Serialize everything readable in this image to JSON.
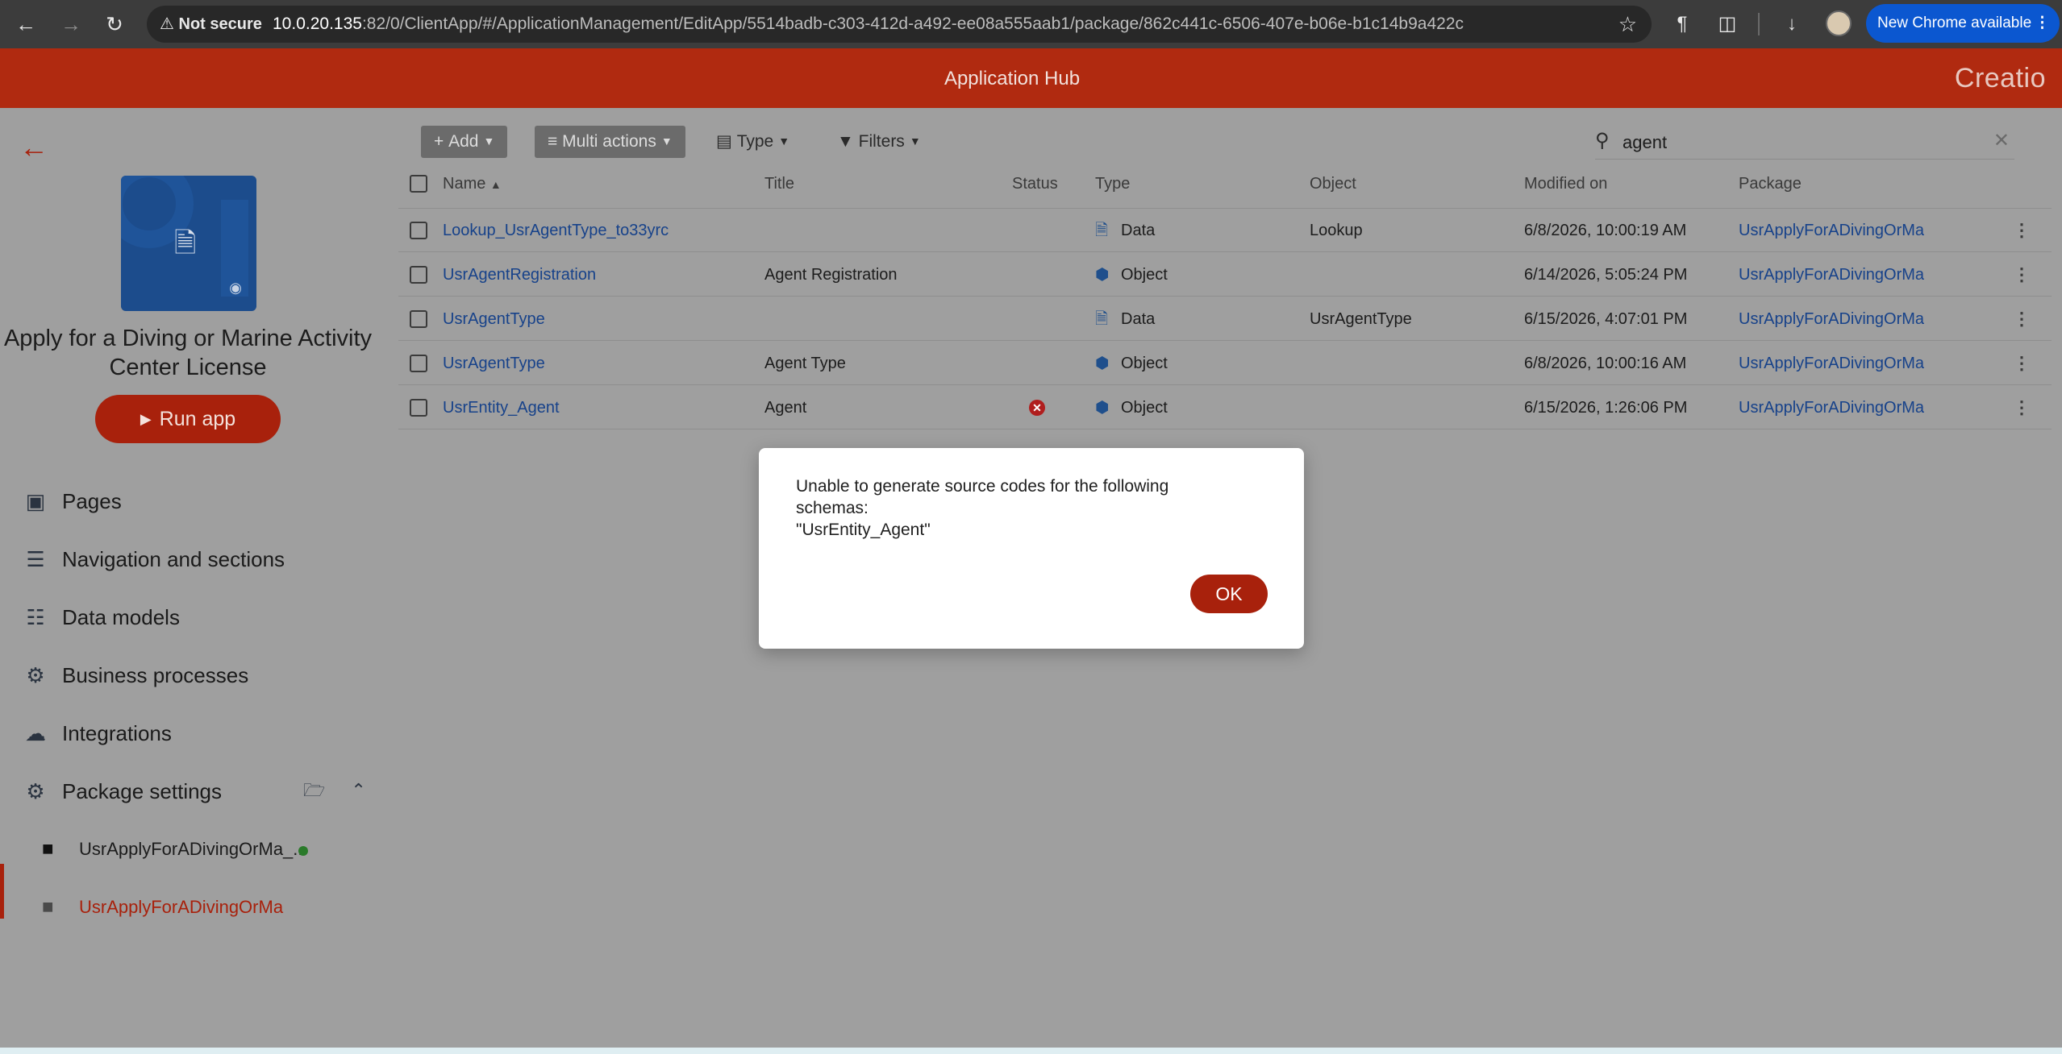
{
  "browser": {
    "security_label": "Not secure",
    "url_host": "10.0.20.135",
    "url_rest": ":82/0/ClientApp/#/ApplicationManagement/EditApp/5514badb-c303-412d-a492-ee08a555aab1/package/862c441c-6506-407e-b06e-b1c14b9a422c",
    "new_chrome_label": "New Chrome available"
  },
  "header": {
    "title": "Application Hub",
    "logo": "Creatio"
  },
  "app": {
    "name": "Apply for a Diving or Marine Activity Center License",
    "run_label": "Run app"
  },
  "menu": [
    {
      "label": "Pages",
      "icon": "window-icon"
    },
    {
      "label": "Navigation and sections",
      "icon": "list-icon"
    },
    {
      "label": "Data models",
      "icon": "database-icon"
    },
    {
      "label": "Business processes",
      "icon": "process-icon"
    },
    {
      "label": "Integrations",
      "icon": "cloud-icon"
    },
    {
      "label": "Package settings",
      "icon": "gear-icon"
    }
  ],
  "packages": [
    {
      "label": "UsrApplyForADivingOrMa_...",
      "active": false
    },
    {
      "label": "UsrApplyForADivingOrMa",
      "active": true
    }
  ],
  "toolbar": {
    "add": "Add",
    "multi": "Multi actions",
    "type": "Type",
    "filters": "Filters"
  },
  "search": {
    "value": "agent"
  },
  "columns": {
    "name": "Name",
    "title": "Title",
    "status": "Status",
    "type": "Type",
    "object": "Object",
    "modified": "Modified on",
    "package": "Package"
  },
  "rows": [
    {
      "name": "Lookup_UsrAgentType_to33yrc",
      "title": "",
      "status_error": false,
      "type": "Data",
      "type_icon": "document-icon",
      "object": "Lookup",
      "modified": "6/8/2026, 10:00:19 AM",
      "package": "UsrApplyForADivingOrMa"
    },
    {
      "name": "UsrAgentRegistration",
      "title": "Agent Registration",
      "status_error": false,
      "type": "Object",
      "type_icon": "cube-icon",
      "object": "",
      "modified": "6/14/2026, 5:05:24 PM",
      "package": "UsrApplyForADivingOrMa"
    },
    {
      "name": "UsrAgentType",
      "title": "",
      "status_error": false,
      "type": "Data",
      "type_icon": "document-icon",
      "object": "UsrAgentType",
      "modified": "6/15/2026, 4:07:01 PM",
      "package": "UsrApplyForADivingOrMa"
    },
    {
      "name": "UsrAgentType",
      "title": "Agent Type",
      "status_error": false,
      "type": "Object",
      "type_icon": "cube-icon",
      "object": "",
      "modified": "6/8/2026, 10:00:16 AM",
      "package": "UsrApplyForADivingOrMa"
    },
    {
      "name": "UsrEntity_Agent",
      "title": "Agent",
      "status_error": true,
      "type": "Object",
      "type_icon": "cube-icon",
      "object": "",
      "modified": "6/15/2026, 1:26:06 PM",
      "package": "UsrApplyForADivingOrMa"
    }
  ],
  "dialog": {
    "message": "Unable to generate source codes for the following\nschemas:\n\"UsrEntity_Agent\"",
    "ok_label": "OK"
  },
  "colors": {
    "brand": "#b02a10",
    "accent": "#a8210c",
    "link": "#17428a"
  }
}
